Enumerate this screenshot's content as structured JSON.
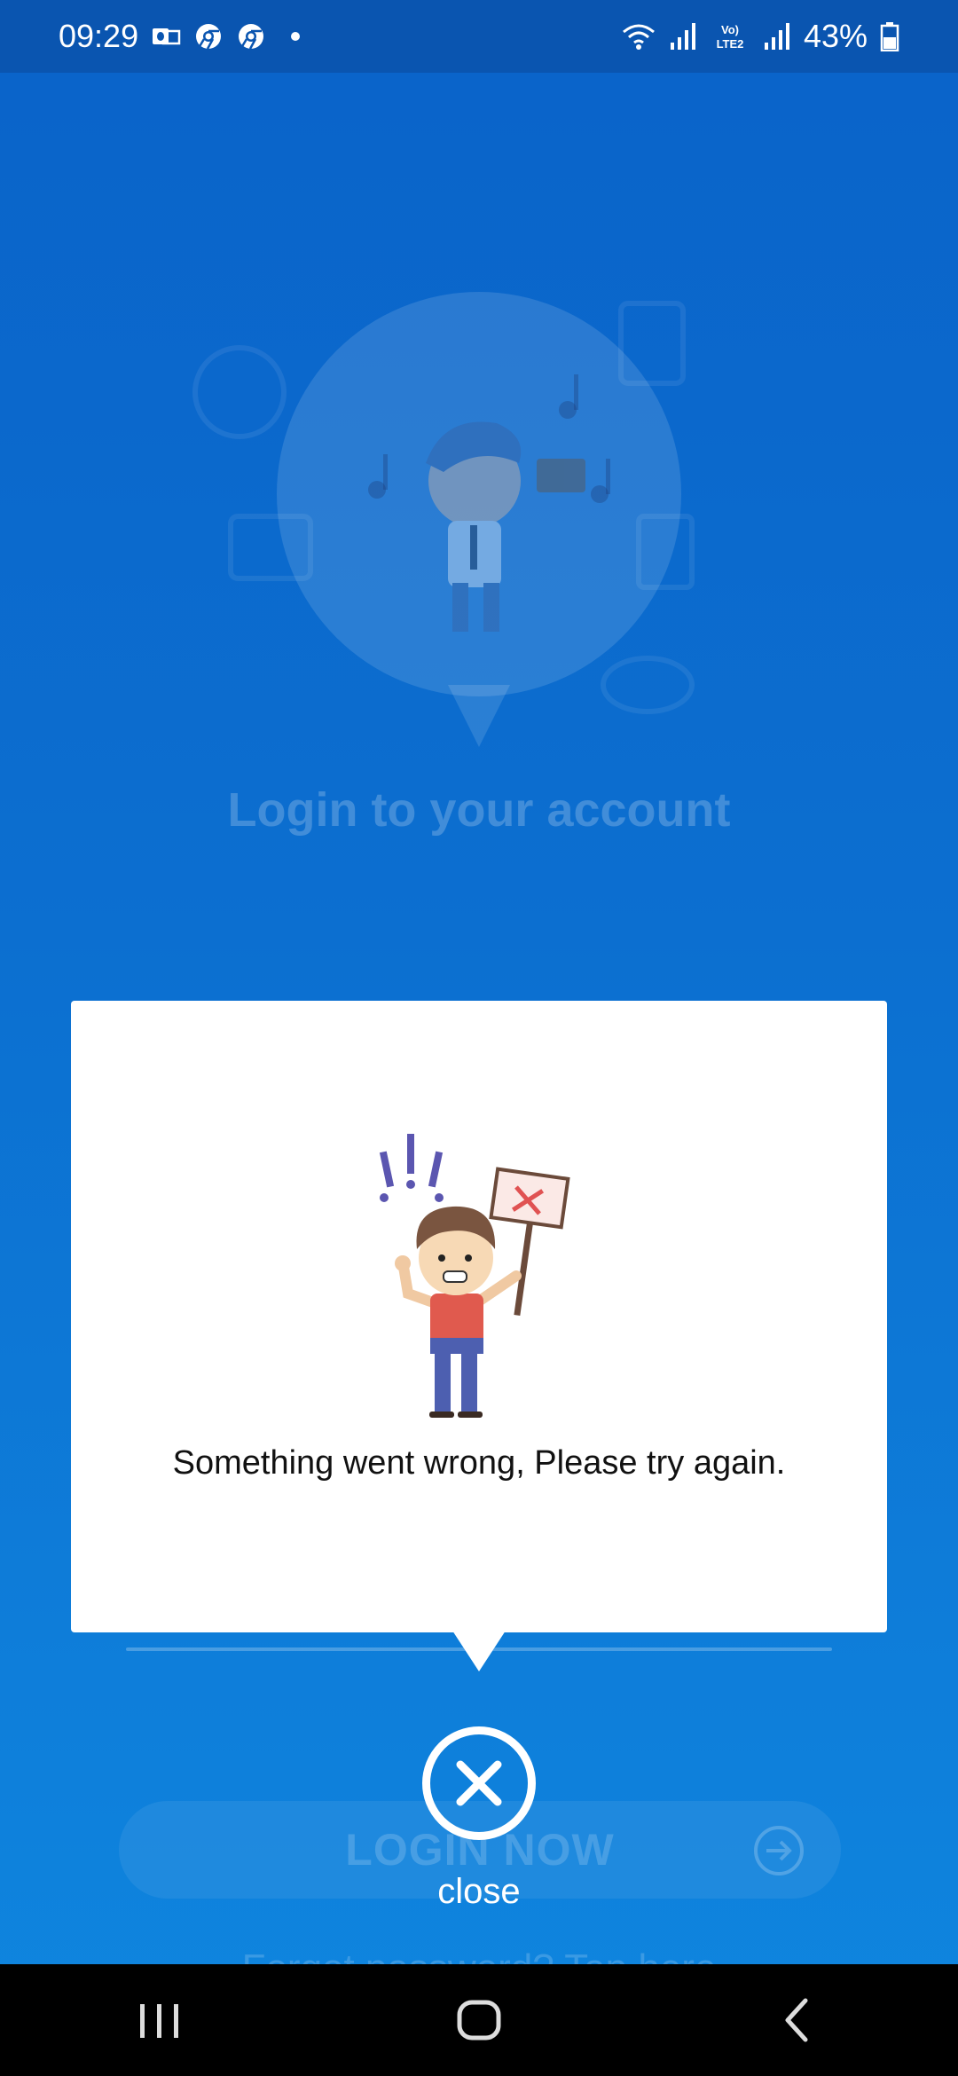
{
  "status_bar": {
    "time": "09:29",
    "battery": "43%",
    "left_icons": [
      "outlook-icon",
      "chrome-icon",
      "chrome-icon",
      "notification-dot"
    ],
    "right_icons": [
      "wifi-icon",
      "signal-icon",
      "volte-lte2-icon",
      "signal-icon",
      "battery-icon"
    ]
  },
  "background": {
    "title": "Login to your account",
    "login_button_label": "LOGIN NOW",
    "forgot_text": "Forgot password?",
    "forgot_link": "Tap here"
  },
  "dialog": {
    "message": "Something went wrong, Please try again.",
    "close_label": "close"
  },
  "nav_bar": {
    "buttons": [
      "recent-apps-icon",
      "home-icon",
      "back-icon"
    ]
  },
  "colors": {
    "background_top": "#0a63c9",
    "background_bottom": "#0f86df",
    "status_bar": "#0a55b0",
    "dialog": "#ffffff",
    "nav_bar": "#000000"
  }
}
